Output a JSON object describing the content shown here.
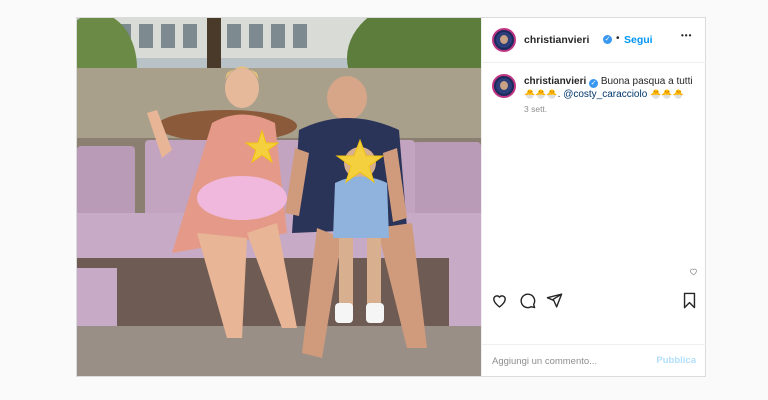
{
  "post": {
    "author": {
      "username": "christianvieri",
      "verified": true,
      "avatar_icon": "avatar-image"
    },
    "header": {
      "separator": "•",
      "follow_label": "Segui",
      "more_label": "•••"
    },
    "caption": {
      "username": "christianvieri",
      "text_before": "Buona pasqua a tutti",
      "emojis_1": "🐣🐣🐣",
      "emojis_2": "🐣🐣🐣",
      "mention": "@costy_caracciolo",
      "period": ".",
      "time_ago": "3 sett."
    },
    "actions": {
      "like_icon": "heart-icon",
      "comment_icon": "comment-icon",
      "share_icon": "send-icon",
      "save_icon": "bookmark-icon"
    },
    "comment_box": {
      "placeholder": "Aggiungi un commento...",
      "publish_label": "Pubblica"
    },
    "colors": {
      "link_blue": "#0095f6",
      "publish_disabled": "#b2dffc",
      "mention": "#00376b",
      "verified": "#3897f0"
    }
  }
}
